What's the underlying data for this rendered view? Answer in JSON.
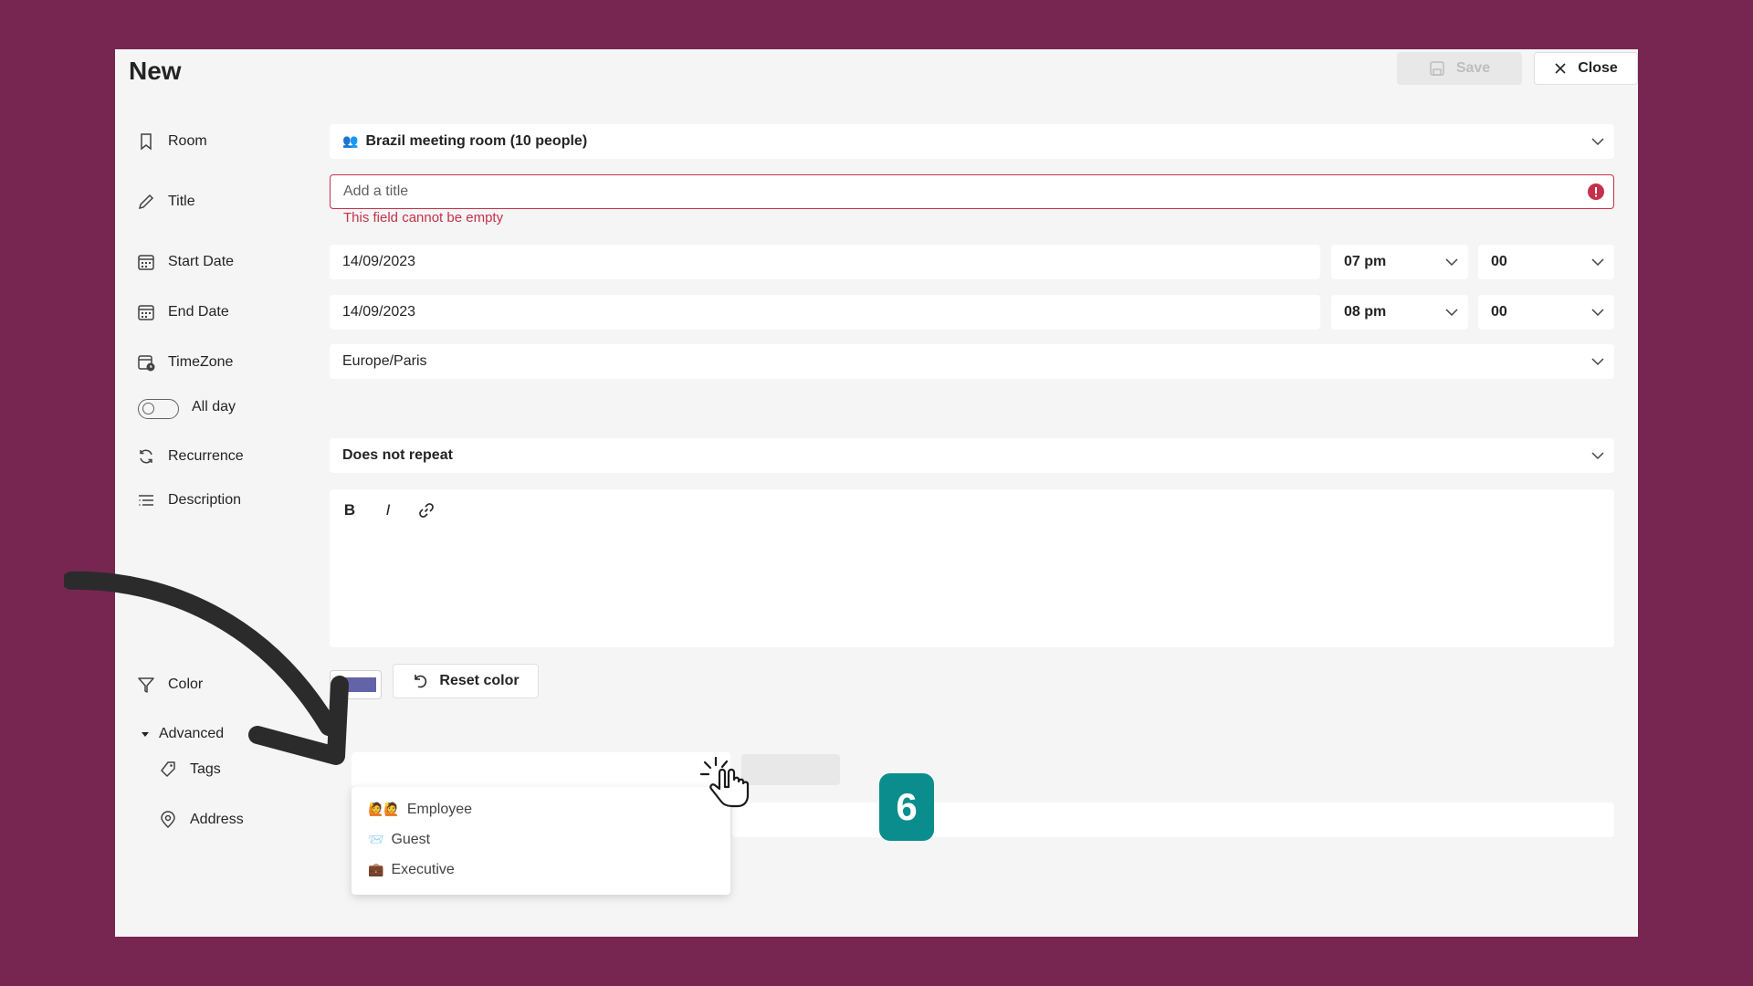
{
  "panel": {
    "title": "New"
  },
  "toolbar": {
    "save_label": "Save",
    "close_label": "Close"
  },
  "labels": {
    "room": "Room",
    "title": "Title",
    "start_date": "Start Date",
    "end_date": "End Date",
    "timezone": "TimeZone",
    "all_day": "All day",
    "recurrence": "Recurrence",
    "description": "Description",
    "color": "Color",
    "advanced": "Advanced",
    "tags": "Tags",
    "address": "Address"
  },
  "fields": {
    "room": "Brazil meeting room (10 people)",
    "title_placeholder": "Add a title",
    "title_error": "This field cannot be empty",
    "start_date": "14/09/2023",
    "start_hour": "07 pm",
    "start_minute": "00",
    "end_date": "14/09/2023",
    "end_hour": "08 pm",
    "end_minute": "00",
    "timezone": "Europe/Paris",
    "recurrence": "Does not repeat"
  },
  "all_day_on": false,
  "editor_tools": {
    "bold": "B",
    "italic": "I"
  },
  "color": {
    "value": "#6264a7",
    "reset_label": "Reset color"
  },
  "tag_options": [
    {
      "icon": "🙋🙋",
      "label": "Employee"
    },
    {
      "icon": "📨",
      "label": "Guest"
    },
    {
      "icon": "💼",
      "label": "Executive"
    }
  ],
  "overlay": {
    "step_number": "6"
  },
  "colors": {
    "background": "#772651",
    "error": "#c4314b",
    "step_badge": "#0b8d8e"
  }
}
